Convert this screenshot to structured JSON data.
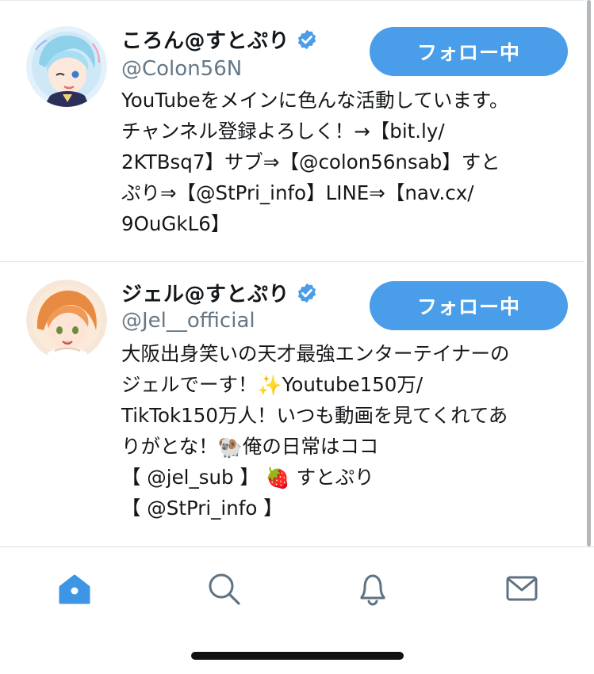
{
  "users": [
    {
      "display_name": "ころん@すとぷり",
      "handle": "@Colon56N",
      "follow_label": "フォロー中",
      "bio_lines": [
        "YouTubeをメインに色んな活動しています。",
        "チャンネル登録よろしく！→【bit.ly/",
        "2KTBsq7】サブ⇒【@colon56nsab】すと",
        "ぷり⇒【@StPri_info】LINE⇒【nav.cx/",
        "9OuGkL6】"
      ]
    },
    {
      "display_name": "ジェル@すとぷり",
      "handle": "@Jel__official",
      "follow_label": "フォロー中",
      "bio_lines": [
        "大阪出身笑いの天才最強エンターテイナーの",
        {
          "pre": "ジェルでーす！",
          "emoji": "✨",
          "post": "Youtube150万/"
        },
        "TikTok150万人！いつも動画を見てくれてあ",
        {
          "pre": "りがとな！",
          "emoji": "🐏",
          "post": "俺の日常はココ"
        },
        {
          "pre": "【 @jel_sub 】 ",
          "emoji": "🍓",
          "post": " すとぷり"
        },
        "【 @StPri_info 】"
      ]
    }
  ],
  "tabs": [
    "home",
    "search",
    "notifications",
    "messages"
  ],
  "active_tab": "home",
  "colors": {
    "accent": "#4a9ee9",
    "active_tab_icon": "#3d95e5",
    "inactive_tab_icon": "#5f7282",
    "handle_gray": "#657786",
    "verified_badge": "#4a9ee9",
    "divider": "#d8dde2"
  },
  "icons": {
    "verified": "verified-badge-icon",
    "home": "home-icon",
    "search": "search-icon",
    "notifications": "bell-icon",
    "messages": "envelope-icon"
  }
}
